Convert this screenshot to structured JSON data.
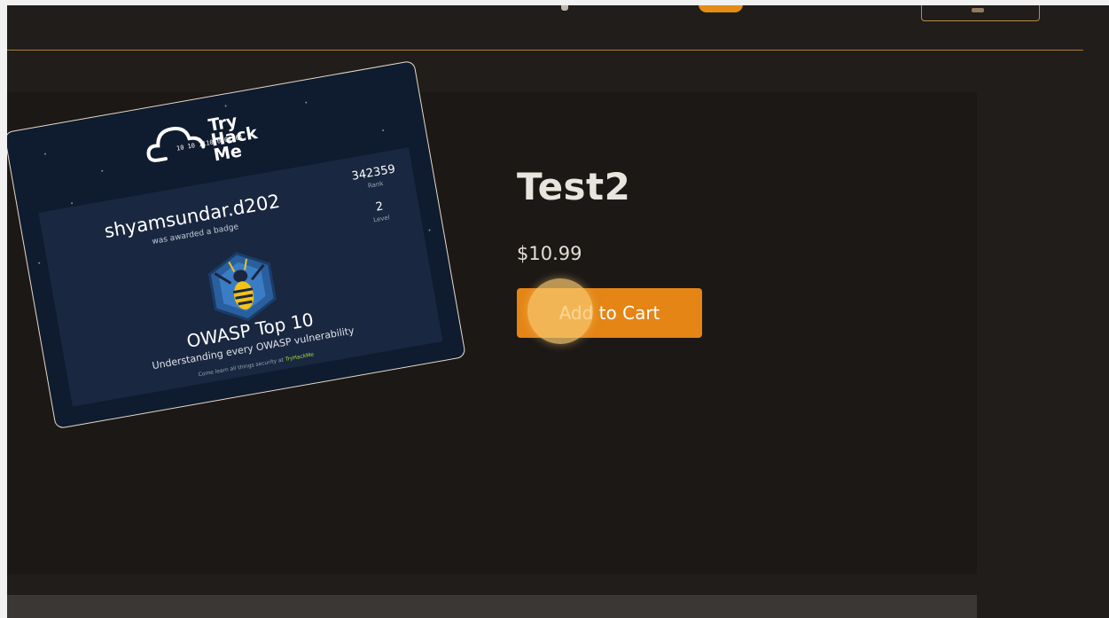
{
  "product": {
    "title": "Test2",
    "price": "$10.99",
    "add_to_cart_label": "Add to Cart"
  },
  "badge_image": {
    "logo_text": "Try Hack Me",
    "binary_text": "10 10 1110 0101 01",
    "username": "shyamsundar.d202",
    "awarded_text": "was awarded a badge",
    "rank_value": "342359",
    "rank_label": "Rank",
    "level_value": "2",
    "level_label": "Level",
    "course_name": "OWASP Top 10",
    "course_desc": "Understanding every OWASP vulnerability",
    "footer_text": "Come learn all things security at",
    "footer_link": "TryHackMe"
  },
  "colors": {
    "accent": "#e48516",
    "page_bg": "#211d1a",
    "card_bg": "#1c1815",
    "badge_bg": "#0f1b2e"
  }
}
